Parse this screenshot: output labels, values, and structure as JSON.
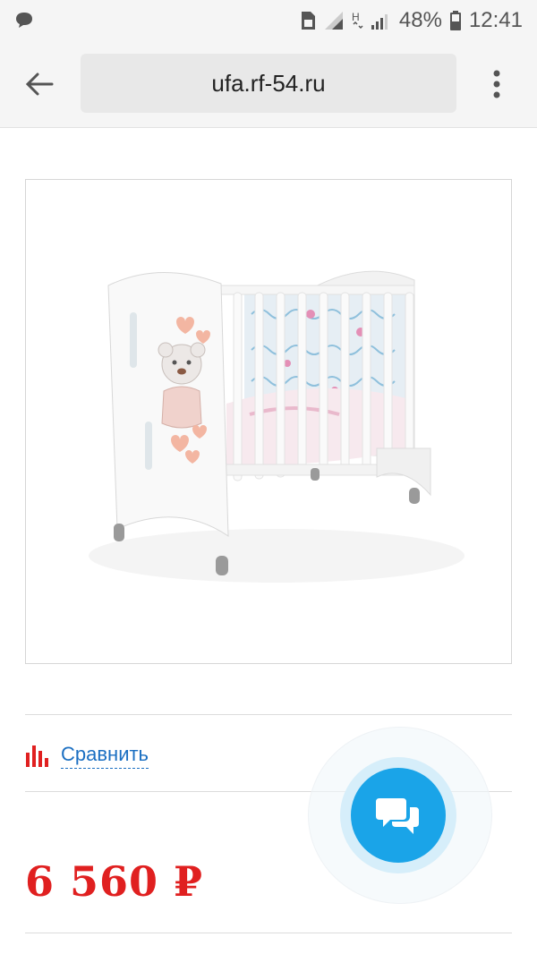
{
  "status_bar": {
    "battery_percent": "48%",
    "time": "12:41"
  },
  "browser": {
    "url": "ufa.rf-54.ru"
  },
  "product": {
    "image_alt": "product-photo-crib",
    "compare_label": "Сравнить",
    "price": "6 560 ₽"
  },
  "colors": {
    "price": "#e02020",
    "link": "#1b6fc2",
    "fab": "#1aa4e8",
    "compare_icon": "#e02020"
  }
}
